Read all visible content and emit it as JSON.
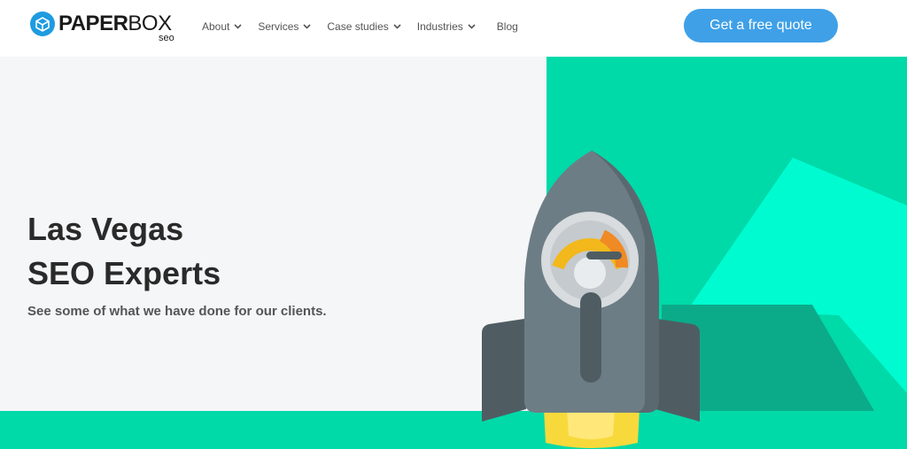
{
  "brand": {
    "name_bold": "PAPER",
    "name_light": "BOX",
    "sub": "seo"
  },
  "nav": [
    {
      "label": "About",
      "has_dropdown": true
    },
    {
      "label": "Services",
      "has_dropdown": true
    },
    {
      "label": "Case studies",
      "has_dropdown": true
    },
    {
      "label": "Industries",
      "has_dropdown": true
    },
    {
      "label": "Blog",
      "has_dropdown": false
    }
  ],
  "cta": {
    "label": "Get a free quote"
  },
  "hero": {
    "title_line1": "Las Vegas",
    "title_line2": "SEO Experts",
    "subtitle": "See some of what we have done for our clients."
  },
  "icons": {
    "logo": "box-icon",
    "dropdown": "chevron-down-icon",
    "illustration": "rocket-illustration"
  },
  "colors": {
    "accent": "#3fa0e8",
    "teal": "#00d9a8",
    "mint": "#00fbd0",
    "rocket_body": "#6d7d86",
    "text_dark": "#2a2a2a"
  }
}
